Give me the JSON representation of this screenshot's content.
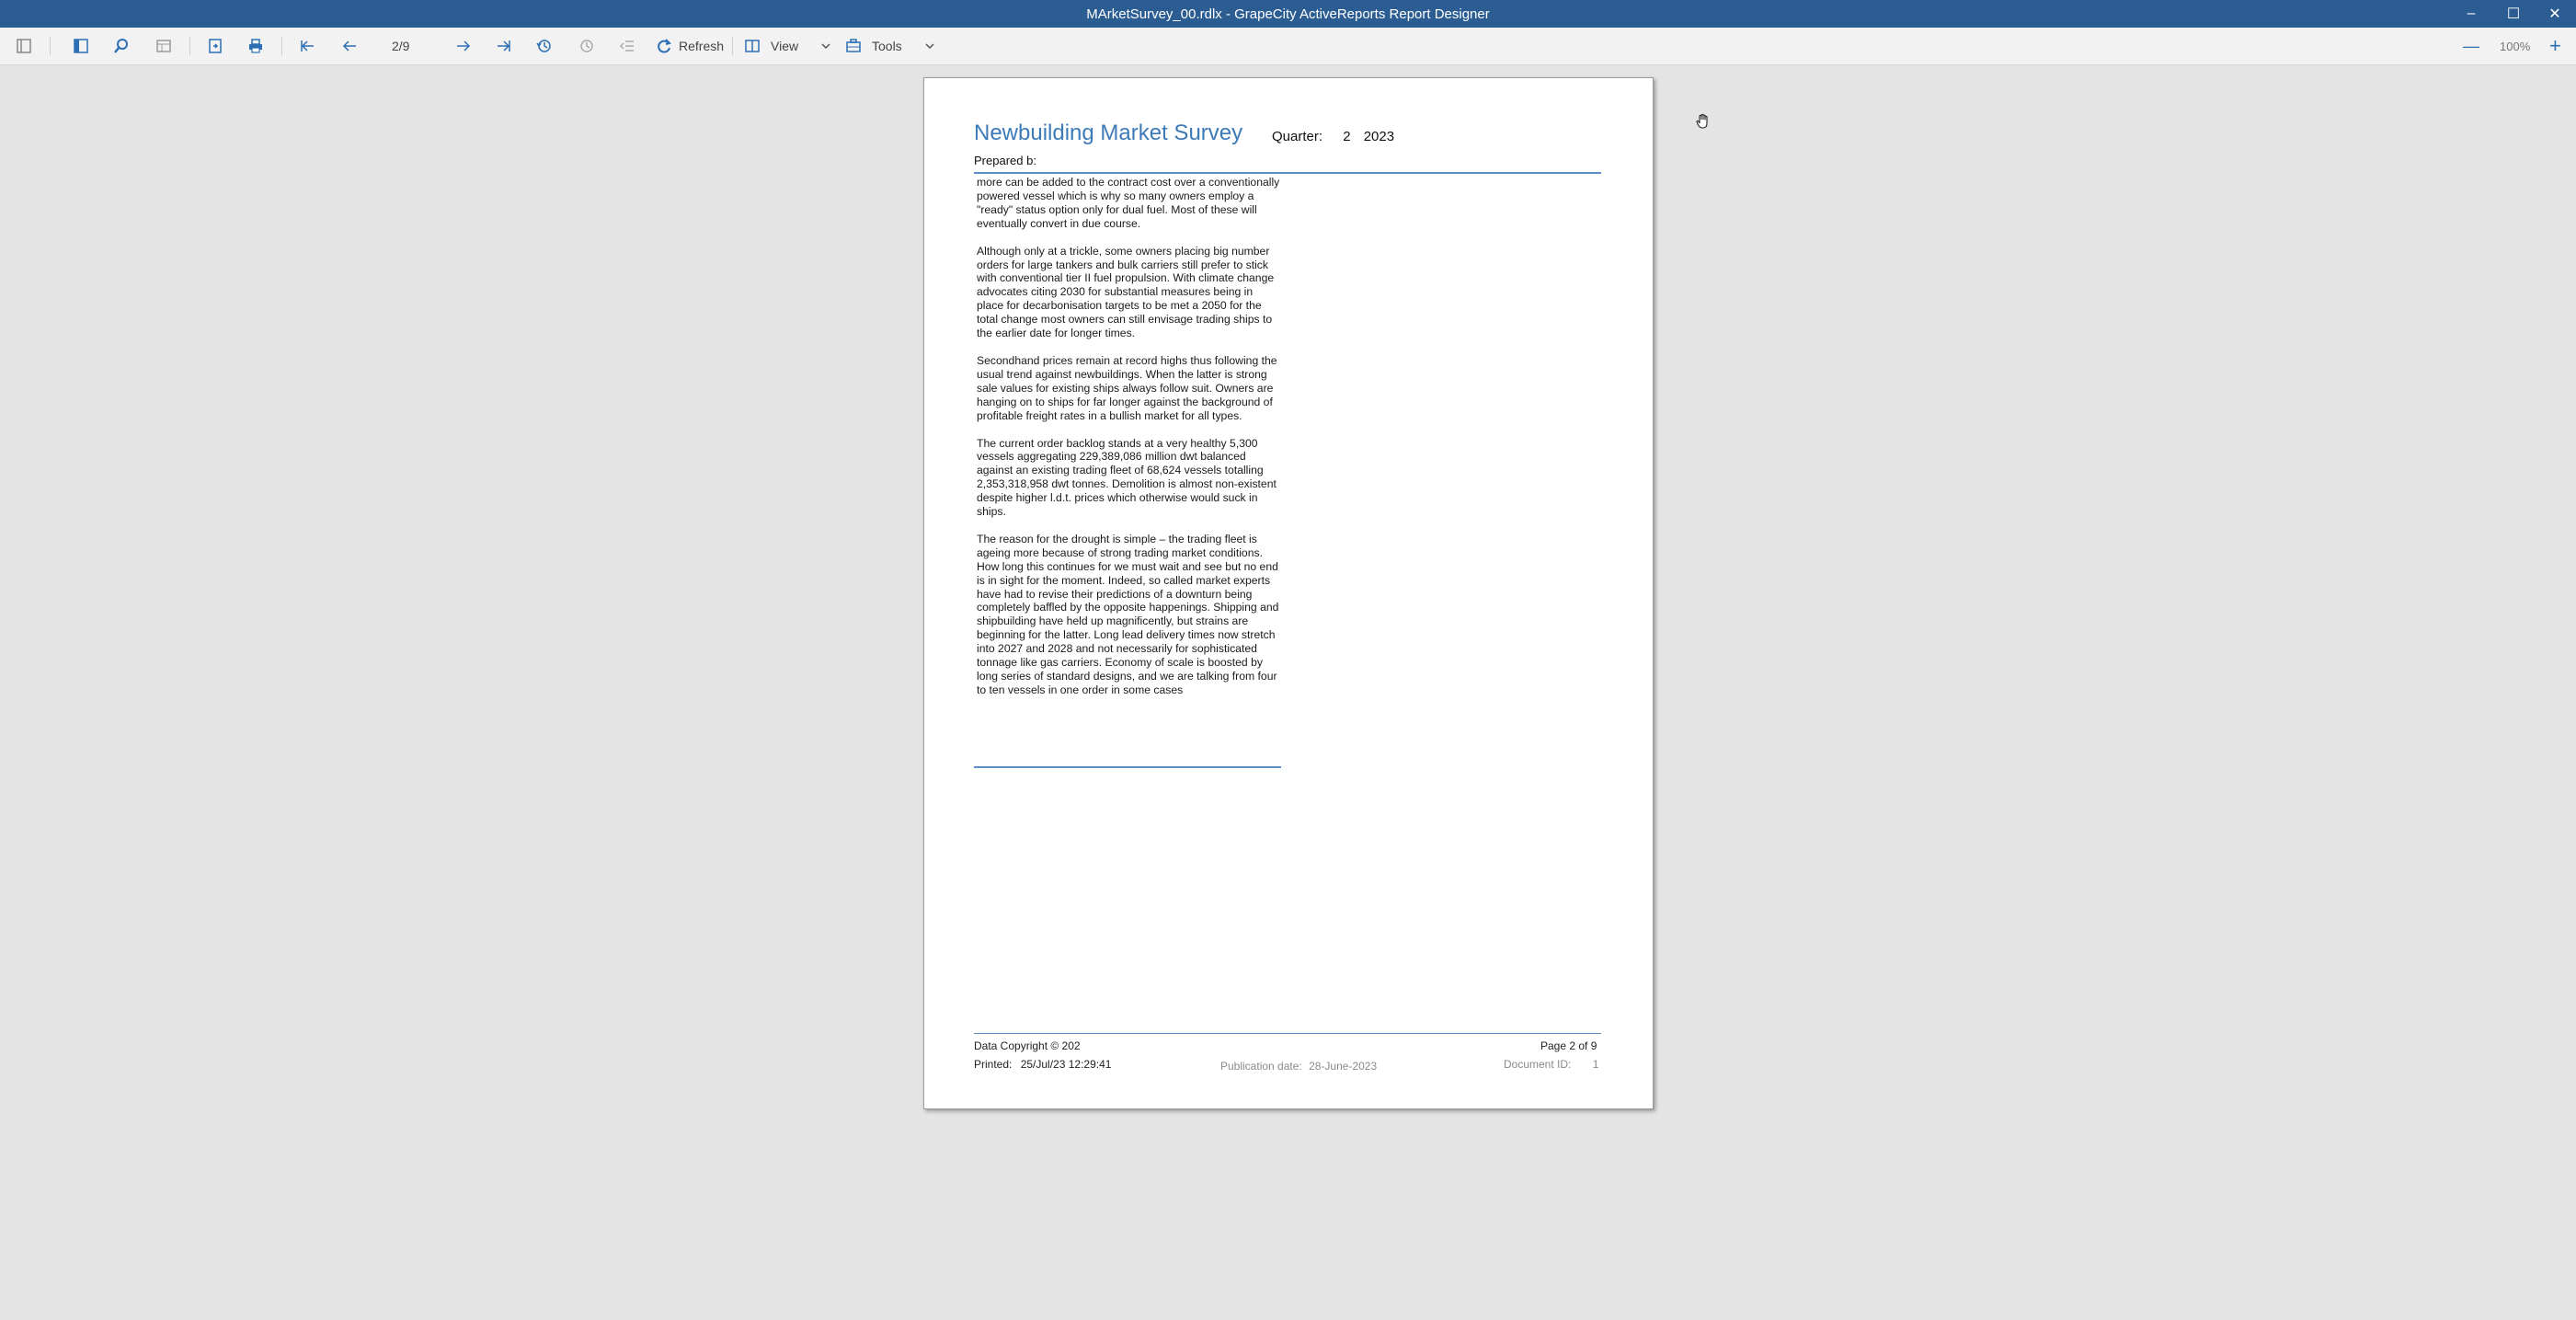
{
  "window": {
    "title": "MArketSurvey_00.rdlx - GrapeCity ActiveReports Report Designer",
    "minimize": "–",
    "maximize": "☐",
    "close": "✕"
  },
  "toolbar": {
    "page_indicator": "2/9",
    "refresh_label": "Refresh",
    "view_label": "View",
    "tools_label": "Tools",
    "zoom_level": "100%",
    "zoom_out": "—",
    "zoom_in": "+"
  },
  "report": {
    "title": "Newbuilding Market Survey",
    "quarter_label": "Quarter:",
    "quarter_value": "2",
    "year_value": "2023",
    "prepared_by": "Prepared b:",
    "paragraphs": [
      "more can be added to the contract cost over a conventionally powered vessel which is why so many owners employ a \"ready\" status option only for dual fuel. Most of these will eventually convert in due course.",
      "Although only at a trickle, some owners placing big number orders for large tankers and bulk carriers still prefer to stick with conventional tier II fuel propulsion. With climate change advocates citing 2030 for substantial measures being in place for decarbonisation targets to be met a 2050 for the total change most owners can still envisage trading ships to the earlier date for longer times.",
      "Secondhand prices remain at record highs thus following the usual trend against newbuildings. When the latter is strong sale values for existing ships always follow suit. Owners are hanging on to ships for far longer against the background of profitable freight rates in a bullish market for all types.",
      "The current order backlog stands at a very healthy 5,300 vessels aggregating 229,389,086 million dwt balanced against an existing trading fleet of 68,624 vessels totalling 2,353,318,958 dwt tonnes. Demolition is almost non-existent despite higher l.d.t. prices which otherwise would suck in ships.",
      "The reason for the drought is simple – the trading fleet is ageing more because of strong trading market conditions. How long this continues for we must wait and see but no end is in sight for the moment. Indeed, so called market experts have had to revise their predictions of a downturn being completely baffled by the opposite happenings. Shipping and shipbuilding have held up magnificently, but strains are beginning for the latter. Long lead delivery times now stretch into 2027 and 2028 and not necessarily for sophisticated tonnage like gas carriers. Economy of scale is boosted by long series of standard designs, and we are talking from four to ten vessels in one order in some cases"
    ],
    "footer": {
      "copyright": "Data Copyright © 202",
      "page_of": "Page 2 of 9",
      "printed_label": "Printed:",
      "printed_value": "25/Jul/23 12:29:41",
      "publication_label": "Publication date:",
      "publication_value": "28-June-2023",
      "document_id_label": "Document ID:",
      "document_id_value": "1"
    }
  }
}
